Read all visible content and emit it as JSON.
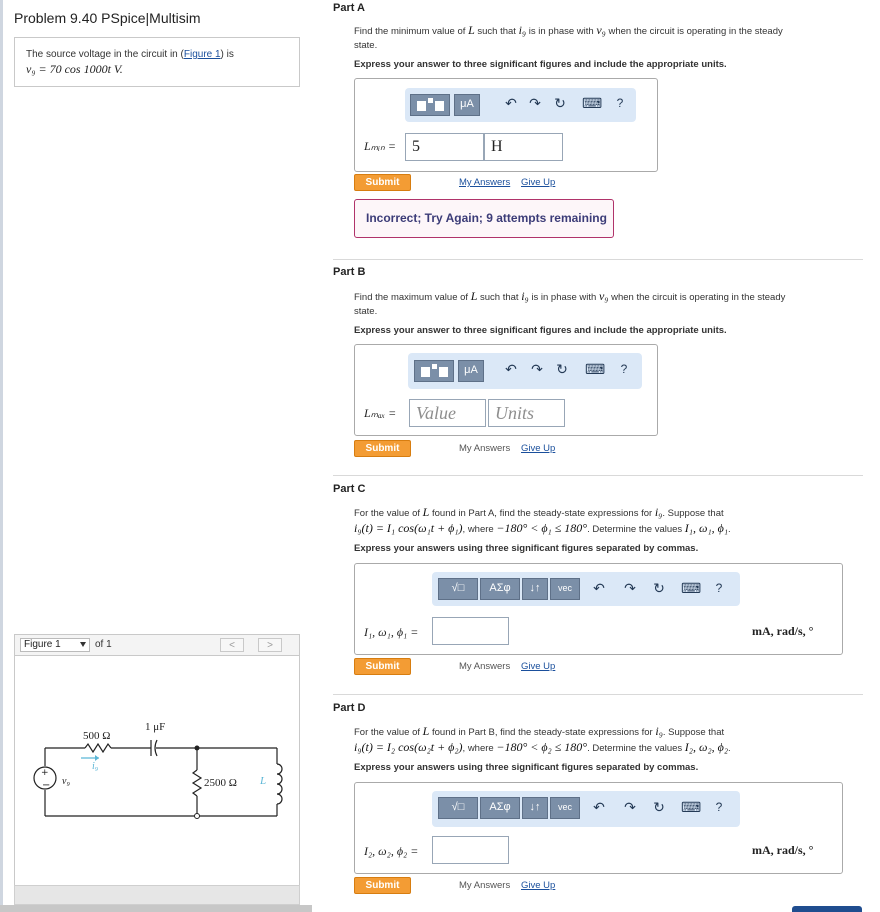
{
  "left": {
    "problem_title": "Problem 9.40 PSpice|Multisim",
    "source_text_prefix": "The source voltage in the circuit in (",
    "figure_link": "Figure 1",
    "source_text_suffix": ") is",
    "source_equation": "v₉ = 70 cos 1000t V.",
    "figure_bar": {
      "select_value": "Figure 1",
      "of_label": "of 1",
      "prev": "<",
      "next": ">"
    },
    "circuit": {
      "r1": "500 Ω",
      "c1": "1 μF",
      "r2": "2500 Ω",
      "inductor": "L",
      "current": "i₉",
      "source": "v₉",
      "plus": "+",
      "minus": "−"
    }
  },
  "toolbar_a": {
    "units_btn": "μA",
    "undo": "↶",
    "redo": "↷",
    "reset": "↻",
    "keyboard": "⌨",
    "help": "?"
  },
  "toolbar_cd": {
    "root_btn": "√□",
    "greek_btn": "ΑΣφ",
    "arrows_btn": "↓↑",
    "vec_btn": "vec",
    "undo": "↶",
    "redo": "↷",
    "reset": "↻",
    "keyboard": "⌨",
    "help": "?"
  },
  "parts": {
    "a": {
      "label": "Part A",
      "question_1": "Find the minimum value of",
      "q_L": "L",
      "question_2": "such that",
      "q_ig": "i₉",
      "question_3": "is in phase with",
      "q_vg": "v₉",
      "question_4": "when the circuit is operating in the steady",
      "question_5": "state.",
      "instruction": "Express your answer to three significant figures and include the appropriate units.",
      "var_label": "Lₘᵢₙ =",
      "value": "5",
      "units": "H",
      "submit": "Submit",
      "my_answers": "My Answers",
      "give_up": "Give Up",
      "feedback": "Incorrect; Try Again; 9 attempts remaining"
    },
    "b": {
      "label": "Part B",
      "question_1": "Find the maximum value of",
      "q_L": "L",
      "question_2": "such that",
      "q_ig": "i₉",
      "question_3": "is in phase with",
      "q_vg": "v₉",
      "question_4": "when the circuit is operating in the steady",
      "question_5": "state.",
      "instruction": "Express your answer to three significant figures and include the appropriate units.",
      "var_label": "Lₘₐₓ =",
      "value_placeholder": "Value",
      "units_placeholder": "Units",
      "submit": "Submit",
      "my_answers": "My Answers",
      "give_up": "Give Up"
    },
    "c": {
      "label": "Part C",
      "question_1": "For the value of",
      "q_L": "L",
      "question_2": "found in Part A, find the steady-state expressions for",
      "q_ig": "i₉",
      "question_3": ". Suppose that",
      "expr": "i₉(t) = I₁ cos(ω₁t + ϕ₁)",
      "question_4": ", where",
      "range": "−180° < ϕ₁ ≤ 180°",
      "question_5": ". Determine the values",
      "vals": "I₁, ω₁, ϕ₁",
      "question_6": ".",
      "instruction": "Express your answers using three significant figures separated by commas.",
      "var_label": "I₁, ω₁, ϕ₁ =",
      "units_tail": "mA, rad/s, °",
      "submit": "Submit",
      "my_answers": "My Answers",
      "give_up": "Give Up"
    },
    "d": {
      "label": "Part D",
      "question_1": "For the value of",
      "q_L": "L",
      "question_2": "found in Part B, find the steady-state expressions for",
      "q_ig": "i₉",
      "question_3": ". Suppose that",
      "expr": "i₉(t) = I₂ cos(ω₂t + ϕ₂)",
      "question_4": ", where",
      "range": "−180° < ϕ₂ ≤ 180°",
      "question_5": ". Determine the values",
      "vals": "I₂, ω₂, ϕ₂",
      "question_6": ".",
      "instruction": "Express your answers using three significant figures separated by commas.",
      "var_label": "I₂, ω₂, ϕ₂ =",
      "units_tail": "mA, rad/s, °",
      "submit": "Submit",
      "my_answers": "My Answers",
      "give_up": "Give Up"
    }
  },
  "colors": {
    "submit": "#f39c34",
    "toolbar": "#dbe8f7",
    "link": "#1a4f9c",
    "feedback_border": "#b0336a"
  }
}
